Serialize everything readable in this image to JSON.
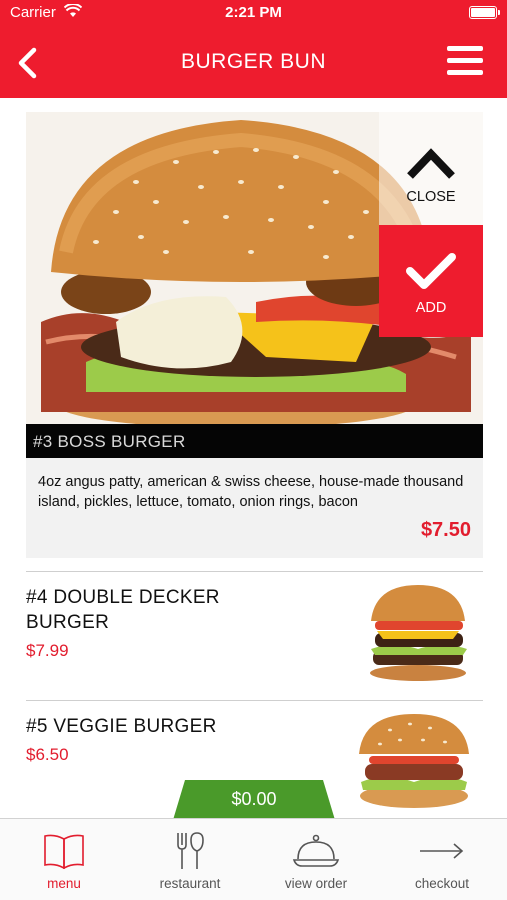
{
  "status_bar": {
    "carrier": "Carrier",
    "time": "2:21 PM"
  },
  "nav": {
    "title": "BURGER BUN"
  },
  "featured": {
    "caption": "#3 BOSS BURGER",
    "description": "4oz angus patty, american & swiss cheese, house-made thousand island, pickles, lettuce, tomato, onion rings, bacon",
    "price": "$7.50",
    "close_label": "CLOSE",
    "add_label": "ADD"
  },
  "items": [
    {
      "name": "#4 DOUBLE DECKER BURGER",
      "price": "$7.99"
    },
    {
      "name": "#5 VEGGIE BURGER",
      "price": "$6.50"
    }
  ],
  "cart": {
    "total": "$0.00"
  },
  "tabs": [
    {
      "label": "menu",
      "icon": "book-icon"
    },
    {
      "label": "restaurant",
      "icon": "fork-knife-icon"
    },
    {
      "label": "view order",
      "icon": "cloche-icon"
    },
    {
      "label": "checkout",
      "icon": "arrow-right-icon"
    }
  ],
  "colors": {
    "brand": "#ee1c2e",
    "price": "#e21d2e",
    "cart": "#4a9a2a"
  }
}
